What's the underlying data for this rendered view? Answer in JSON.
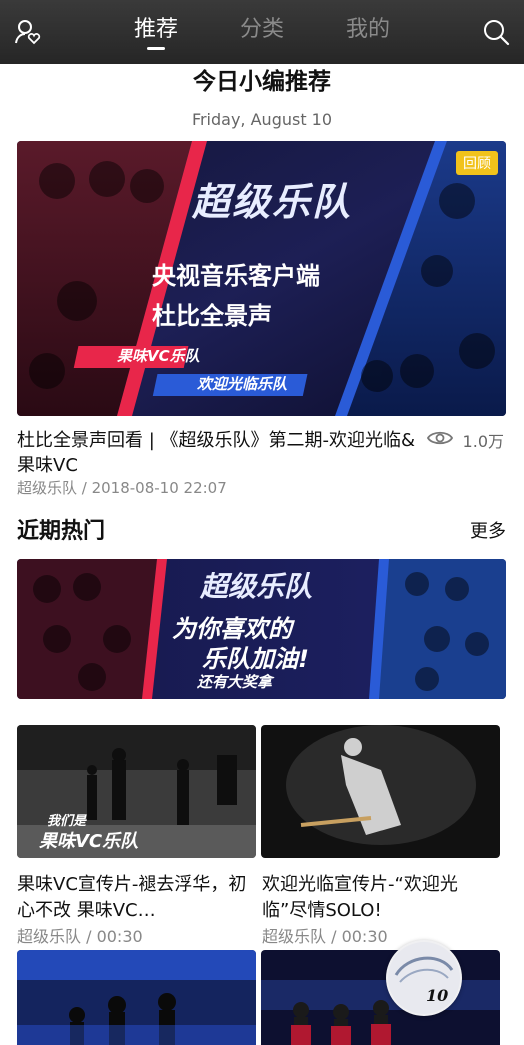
{
  "header": {
    "tabs": [
      {
        "label": "推荐",
        "active": true
      },
      {
        "label": "分类",
        "active": false
      },
      {
        "label": "我的",
        "active": false
      }
    ],
    "left_icon": "user-heart-icon",
    "right_icon": "search-icon"
  },
  "daily": {
    "title": "今日小编推荐",
    "date": "Friday, August 10",
    "badge": "回顾",
    "hero_texts": {
      "logo": "超级乐队",
      "line1": "央视音乐客户端",
      "line2": "杜比全景声",
      "tag1": "果味VC乐队",
      "tag2": "欢迎光临乐队"
    },
    "video_title": "杜比全景声回看 | 《超级乐队》第二期-欢迎光临&果味VC",
    "views": "1.0万",
    "meta": "超级乐队 / 2018-08-10 22:07"
  },
  "hot": {
    "title": "近期热门",
    "more": "更多",
    "banner_texts": {
      "logo": "超级乐队",
      "line1": "为你喜欢的",
      "line2": "乐队加油!",
      "line3": "还有大奖拿"
    },
    "videos": [
      {
        "title": "果味VC宣传片-褪去浮华，初心不改 果味VC…",
        "meta": "超级乐队 / 00:30",
        "thumb_text1": "我们是",
        "thumb_text2": "果味VC乐队"
      },
      {
        "title": "欢迎光临宣传片-“欢迎光临”尽情SOLO!",
        "meta": "超级乐队 / 00:30"
      }
    ],
    "more_thumbs": [
      {
        "badge": "10"
      }
    ]
  },
  "colors": {
    "topbar": "#2e2e2e",
    "badge": "#f1c21b",
    "accent_red": "#e8264a",
    "accent_blue": "#2a5bd7"
  }
}
